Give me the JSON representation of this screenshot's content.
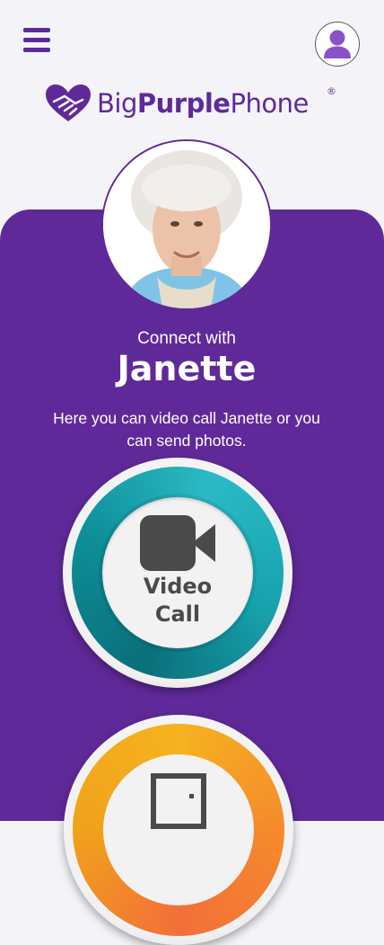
{
  "header": {
    "menu_icon": "hamburger-menu-icon",
    "profile_icon": "user-profile-icon"
  },
  "logo": {
    "text_big": "Big",
    "text_purple": "Purple",
    "text_phone": "Phone",
    "registered": "®",
    "icon": "heart-hands-icon"
  },
  "contact": {
    "connect_label": "Connect with",
    "name": "Janette",
    "description": "Here you can video call Janette or you can send photos."
  },
  "actions": {
    "video_call_label": "Video Call",
    "video_icon": "video-camera-icon",
    "photos_icon": "photo-frame-icon"
  },
  "colors": {
    "brand_purple": "#60299a",
    "teal": "#1aa6b1",
    "orange": "#f39a23"
  }
}
